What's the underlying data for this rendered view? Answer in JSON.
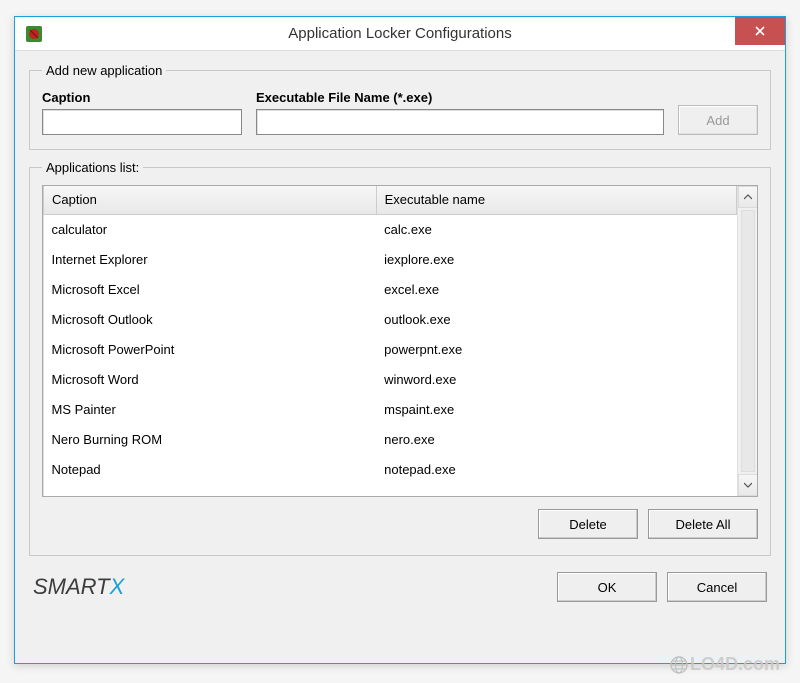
{
  "window": {
    "title": "Application Locker Configurations"
  },
  "add_section": {
    "legend": "Add new application",
    "caption_label": "Caption",
    "caption_value": "",
    "exe_label": "Executable File Name (*.exe)",
    "exe_value": "",
    "add_label": "Add"
  },
  "list_section": {
    "legend": "Applications list:",
    "col_caption": "Caption",
    "col_exe": "Executable name",
    "rows": [
      {
        "caption": "calculator",
        "exe": "calc.exe"
      },
      {
        "caption": "Internet Explorer",
        "exe": "iexplore.exe"
      },
      {
        "caption": "Microsoft Excel",
        "exe": "excel.exe"
      },
      {
        "caption": "Microsoft Outlook",
        "exe": "outlook.exe"
      },
      {
        "caption": "Microsoft PowerPoint",
        "exe": "powerpnt.exe"
      },
      {
        "caption": "Microsoft Word",
        "exe": "winword.exe"
      },
      {
        "caption": "MS Painter",
        "exe": "mspaint.exe"
      },
      {
        "caption": "Nero Burning ROM",
        "exe": "nero.exe"
      },
      {
        "caption": "Notepad",
        "exe": "notepad.exe"
      }
    ],
    "delete_label": "Delete",
    "delete_all_label": "Delete All"
  },
  "footer": {
    "ok_label": "OK",
    "cancel_label": "Cancel",
    "logo_text": "SMART",
    "logo_accent": "X"
  },
  "watermark": {
    "text": "LO4D.com"
  }
}
